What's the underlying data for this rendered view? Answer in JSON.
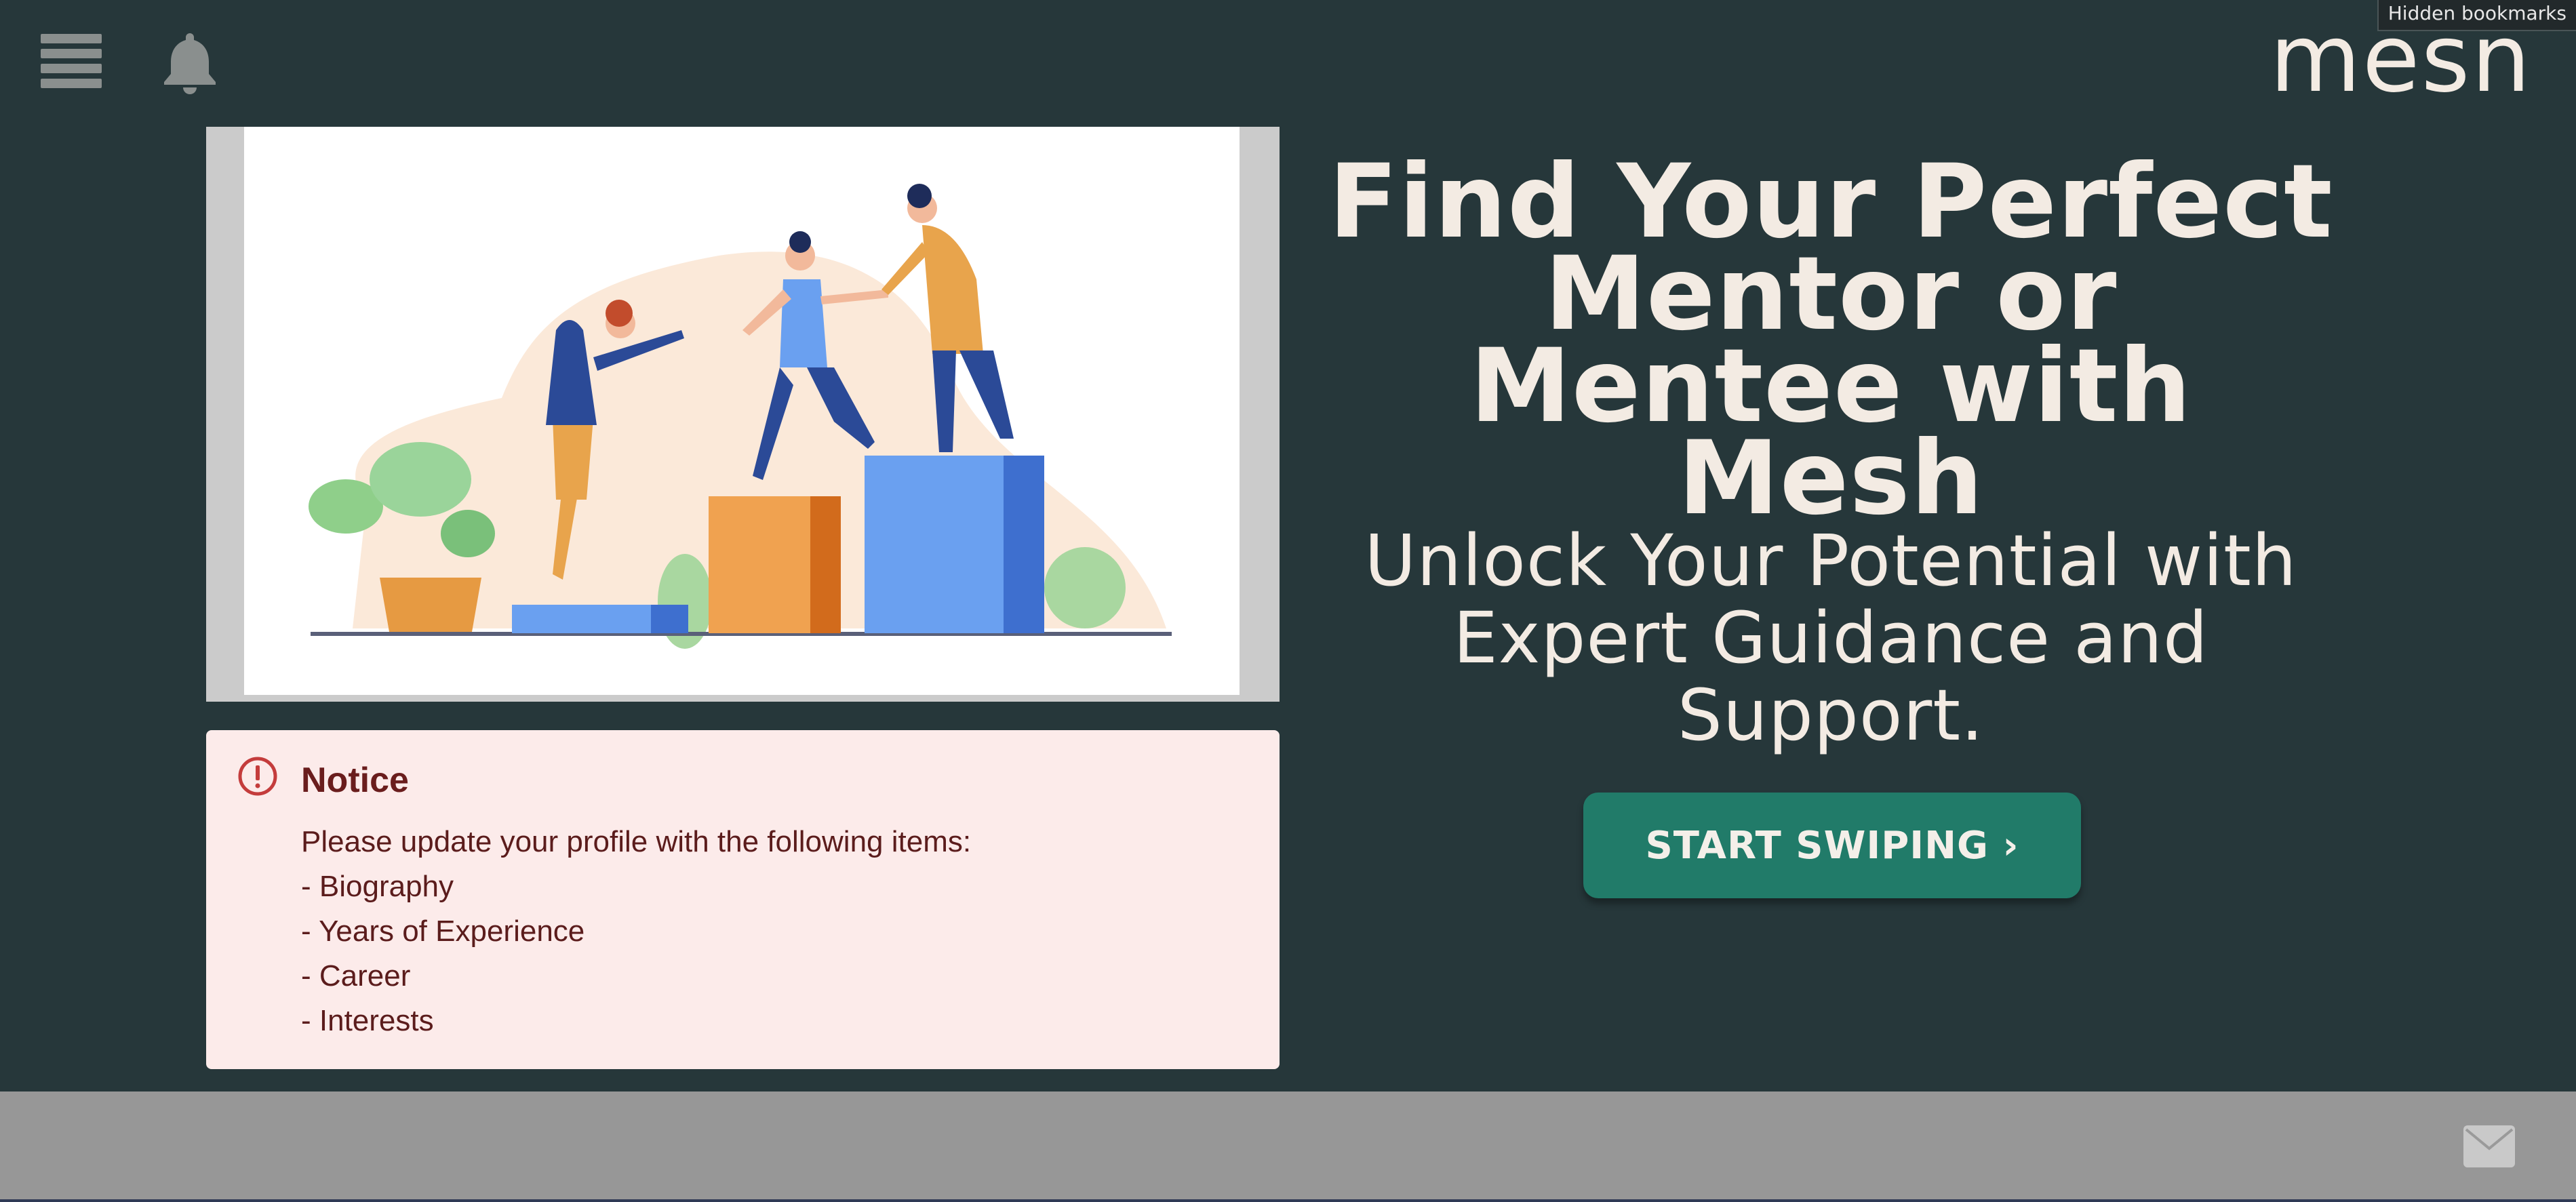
{
  "header": {
    "logo_text": "mesn",
    "bookmarks_label": "Hidden bookmarks",
    "menu_icon": "hamburger-menu-icon",
    "notification_icon": "bell-icon"
  },
  "hero": {
    "illustration": "people-climbing-steps-illustration",
    "headline": "Find Your Perfect Mentor or Mentee with Mesh",
    "subheadline": "Unlock Your Potential with Expert Guidance and Support.",
    "cta_label": "START SWIPING ›"
  },
  "notice": {
    "icon": "alert-circle-icon",
    "title": "Notice",
    "message": "Please update your profile with the following items:",
    "items": [
      "- Biography",
      "- Years of Experience",
      "- Career",
      "- Interests"
    ]
  },
  "footer": {
    "mail_icon": "mail-icon"
  },
  "colors": {
    "background": "#26373a",
    "accent_button": "#217b69",
    "notice_bg": "#fcebea",
    "notice_icon": "#c43c3c",
    "text_light": "#f3ebe3",
    "footer_bg": "#979797"
  }
}
